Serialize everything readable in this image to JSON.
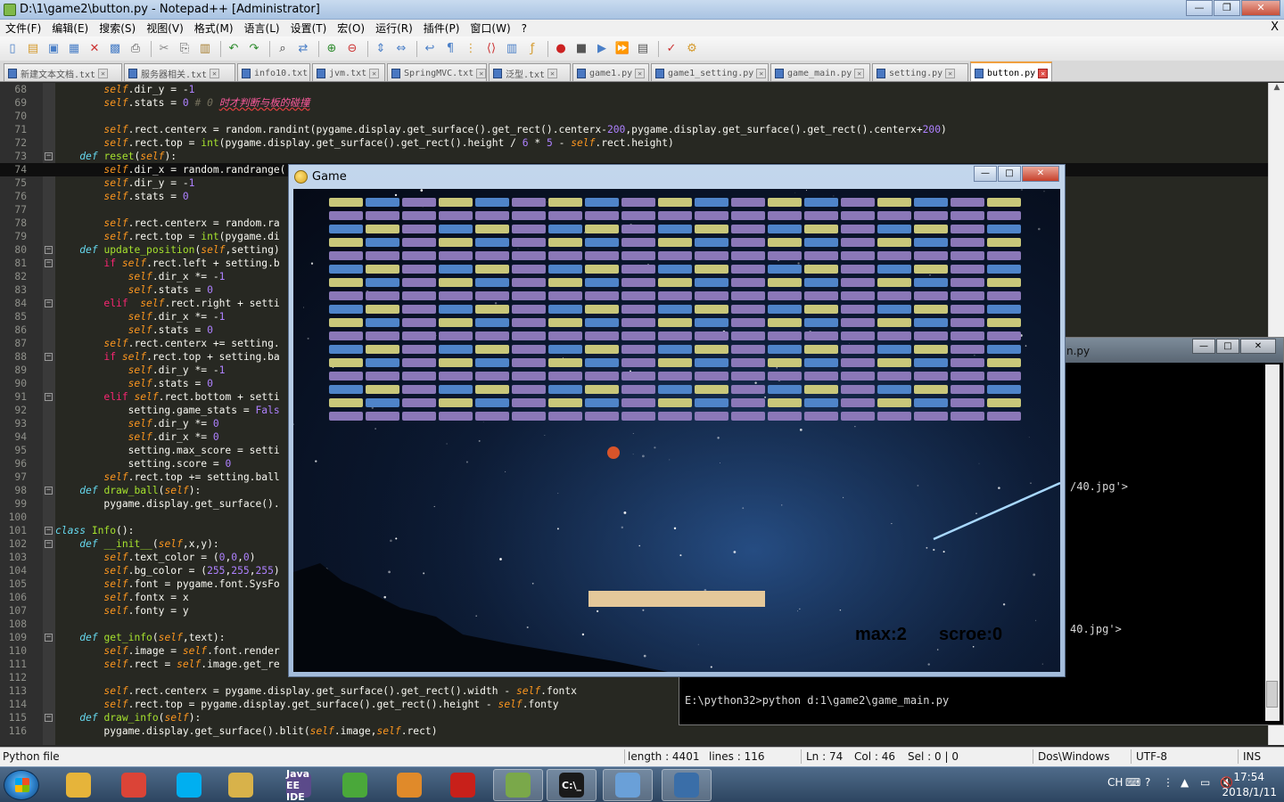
{
  "npp": {
    "title": "D:\\1\\game2\\button.py - Notepad++ [Administrator]",
    "menu": [
      "文件(F)",
      "编辑(E)",
      "搜索(S)",
      "视图(V)",
      "格式(M)",
      "语言(L)",
      "设置(T)",
      "宏(O)",
      "运行(R)",
      "插件(P)",
      "窗口(W)",
      "?"
    ],
    "menu_close": "X",
    "toolbar_icons": [
      "new-file-icon",
      "open-file-icon",
      "save-icon",
      "save-all-icon",
      "close-icon",
      "close-all-icon",
      "print-icon",
      "cut-icon",
      "copy-icon",
      "paste-icon",
      "undo-icon",
      "redo-icon",
      "find-icon",
      "replace-icon",
      "zoom-in-icon",
      "zoom-out-icon",
      "sync-v-icon",
      "sync-h-icon",
      "word-wrap-icon",
      "all-chars-icon",
      "indent-guide-icon",
      "lang-icon",
      "doc-map-icon",
      "function-list-icon",
      "record-macro-icon",
      "stop-macro-icon",
      "play-macro-icon",
      "run-macro-multiple-icon",
      "save-macro-icon",
      "spellcheck-icon",
      "plugin-icon"
    ],
    "tabs": [
      {
        "label": "新建文本文档.txt",
        "active": false
      },
      {
        "label": "服务器相关.txt",
        "active": false
      },
      {
        "label": "info10.txt",
        "active": false
      },
      {
        "label": "jvm.txt",
        "active": false
      },
      {
        "label": "SpringMVC.txt",
        "active": false
      },
      {
        "label": "泛型.txt",
        "active": false
      },
      {
        "label": "game1.py",
        "active": false
      },
      {
        "label": "game1_setting.py",
        "active": false
      },
      {
        "label": "game_main.py",
        "active": false
      },
      {
        "label": "setting.py",
        "active": false
      },
      {
        "label": "button.py",
        "active": true
      }
    ],
    "status": {
      "file_type": "Python file",
      "length": "length : 4401",
      "lines": "lines : 116",
      "ln": "Ln : 74",
      "col": "Col : 46",
      "sel": "Sel : 0 | 0",
      "eol": "Dos\\Windows",
      "encoding": "UTF-8",
      "mode": "INS"
    }
  },
  "code": [
    {
      "n": "68",
      "fold": "",
      "html": "        <span class=\"self\">self</span>.dir_y = -<span class=\"num\">1</span>"
    },
    {
      "n": "69",
      "fold": "",
      "html": "        <span class=\"self\">self</span>.stats = <span class=\"num\">0</span> <span class=\"cm\"># 0 </span><span class=\"cmcn\">时才判断与板的碰撞</span>"
    },
    {
      "n": "70",
      "fold": "",
      "html": ""
    },
    {
      "n": "71",
      "fold": "",
      "html": "        <span class=\"self\">self</span>.rect.centerx = random.randint(pygame.display.get_surface().get_rect().centerx-<span class=\"num\">200</span>,pygame.display.get_surface().get_rect().centerx+<span class=\"num\">200</span>)"
    },
    {
      "n": "72",
      "fold": "",
      "html": "        <span class=\"self\">self</span>.rect.top = <span class=\"fn\">int</span>(pygame.display.get_surface().get_rect().height / <span class=\"num\">6</span> * <span class=\"num\">5</span> - <span class=\"self\">self</span>.rect.height)"
    },
    {
      "n": "73",
      "fold": "−",
      "html": "    <span class=\"kw\">def</span> <span class=\"fn\">reset</span>(<span class=\"self\">self</span>):"
    },
    {
      "n": "74",
      "fold": "",
      "html": "        <span class=\"self\">self</span>.dir_x = random.randrange(",
      "current": true
    },
    {
      "n": "75",
      "fold": "",
      "html": "        <span class=\"self\">self</span>.dir_y = -<span class=\"num\">1</span>"
    },
    {
      "n": "76",
      "fold": "",
      "html": "        <span class=\"self\">self</span>.stats = <span class=\"num\">0</span>"
    },
    {
      "n": "77",
      "fold": "",
      "html": ""
    },
    {
      "n": "78",
      "fold": "",
      "html": "        <span class=\"self\">self</span>.rect.centerx = random.ra"
    },
    {
      "n": "79",
      "fold": "",
      "html": "        <span class=\"self\">self</span>.rect.top = <span class=\"fn\">int</span>(pygame.di"
    },
    {
      "n": "80",
      "fold": "−",
      "html": "    <span class=\"kw\">def</span> <span class=\"fn\">update_position</span>(<span class=\"self\">self</span>,setting)"
    },
    {
      "n": "81",
      "fold": "−",
      "html": "        <span class=\"kw2\">if</span> <span class=\"self\">self</span>.rect.left + setting.b"
    },
    {
      "n": "82",
      "fold": "",
      "html": "            <span class=\"self\">self</span>.dir_x *= -<span class=\"num\">1</span>"
    },
    {
      "n": "83",
      "fold": "",
      "html": "            <span class=\"self\">self</span>.stats = <span class=\"num\">0</span>"
    },
    {
      "n": "84",
      "fold": "−",
      "html": "        <span class=\"kw2\">elif</span>  <span class=\"self\">self</span>.rect.right + setti"
    },
    {
      "n": "85",
      "fold": "",
      "html": "            <span class=\"self\">self</span>.dir_x *= -<span class=\"num\">1</span>"
    },
    {
      "n": "86",
      "fold": "",
      "html": "            <span class=\"self\">self</span>.stats = <span class=\"num\">0</span>"
    },
    {
      "n": "87",
      "fold": "",
      "html": "        <span class=\"self\">self</span>.rect.centerx += setting."
    },
    {
      "n": "88",
      "fold": "−",
      "html": "        <span class=\"kw2\">if</span> <span class=\"self\">self</span>.rect.top + setting.ba"
    },
    {
      "n": "89",
      "fold": "",
      "html": "            <span class=\"self\">self</span>.dir_y *= -<span class=\"num\">1</span>"
    },
    {
      "n": "90",
      "fold": "",
      "html": "            <span class=\"self\">self</span>.stats = <span class=\"num\">0</span>"
    },
    {
      "n": "91",
      "fold": "−",
      "html": "        <span class=\"kw2\">elif</span> <span class=\"self\">self</span>.rect.bottom + setti"
    },
    {
      "n": "92",
      "fold": "",
      "html": "            setting.game_stats = <span class=\"num\">Fals</span>"
    },
    {
      "n": "93",
      "fold": "",
      "html": "            <span class=\"self\">self</span>.dir_y *= <span class=\"num\">0</span>"
    },
    {
      "n": "94",
      "fold": "",
      "html": "            <span class=\"self\">self</span>.dir_x *= <span class=\"num\">0</span>"
    },
    {
      "n": "95",
      "fold": "",
      "html": "            setting.max_score = setti"
    },
    {
      "n": "96",
      "fold": "",
      "html": "            setting.score = <span class=\"num\">0</span>"
    },
    {
      "n": "97",
      "fold": "",
      "html": "        <span class=\"self\">self</span>.rect.top += setting.ball"
    },
    {
      "n": "98",
      "fold": "−",
      "html": "    <span class=\"kw\">def</span> <span class=\"fn\">draw_ball</span>(<span class=\"self\">self</span>):"
    },
    {
      "n": "99",
      "fold": "",
      "html": "        pygame.display.get_surface()."
    },
    {
      "n": "100",
      "fold": "",
      "html": ""
    },
    {
      "n": "101",
      "fold": "−",
      "html": "<span class=\"kw\">class</span> <span class=\"fn\">Info</span>():"
    },
    {
      "n": "102",
      "fold": "−",
      "html": "    <span class=\"kw\">def</span> <span class=\"fn\">__init__</span>(<span class=\"self\">self</span>,x,y):"
    },
    {
      "n": "103",
      "fold": "",
      "html": "        <span class=\"self\">self</span>.text_color = (<span class=\"num\">0</span>,<span class=\"num\">0</span>,<span class=\"num\">0</span>)"
    },
    {
      "n": "104",
      "fold": "",
      "html": "        <span class=\"self\">self</span>.bg_color = (<span class=\"num\">255</span>,<span class=\"num\">255</span>,<span class=\"num\">255</span>)"
    },
    {
      "n": "105",
      "fold": "",
      "html": "        <span class=\"self\">self</span>.font = pygame.font.SysFo"
    },
    {
      "n": "106",
      "fold": "",
      "html": "        <span class=\"self\">self</span>.fontx = x"
    },
    {
      "n": "107",
      "fold": "",
      "html": "        <span class=\"self\">self</span>.fonty = y"
    },
    {
      "n": "108",
      "fold": "",
      "html": ""
    },
    {
      "n": "109",
      "fold": "−",
      "html": "    <span class=\"kw\">def</span> <span class=\"fn\">get_info</span>(<span class=\"self\">self</span>,text):"
    },
    {
      "n": "110",
      "fold": "",
      "html": "        <span class=\"self\">self</span>.image = <span class=\"self\">self</span>.font.render"
    },
    {
      "n": "111",
      "fold": "",
      "html": "        <span class=\"self\">self</span>.rect = <span class=\"self\">self</span>.image.get_re"
    },
    {
      "n": "112",
      "fold": "",
      "html": ""
    },
    {
      "n": "113",
      "fold": "",
      "html": "        <span class=\"self\">self</span>.rect.centerx = pygame.display.get_surface().get_rect().width - <span class=\"self\">self</span>.fontx"
    },
    {
      "n": "114",
      "fold": "",
      "html": "        <span class=\"self\">self</span>.rect.top = pygame.display.get_surface().get_rect().height - <span class=\"self\">self</span>.fonty"
    },
    {
      "n": "115",
      "fold": "−",
      "html": "    <span class=\"kw\">def</span> <span class=\"fn\">draw_info</span>(<span class=\"self\">self</span>):"
    },
    {
      "n": "116",
      "fold": "",
      "html": "        pygame.display.get_surface().blit(<span class=\"self\">self</span>.image,<span class=\"self\">self</span>.rect)"
    }
  ],
  "console": {
    "title_fragment": "n.py",
    "lines": [
      "/40.jpg'>",
      "40.jpg'>",
      "E:\\python32>python d:1\\game2\\game_main.py"
    ]
  },
  "game": {
    "title": "Game",
    "max_label": "max:2",
    "score_label": "scroe:0",
    "brick_colors": [
      "#c9c77a",
      "#8b78b8",
      "#4f84c9"
    ],
    "paddle_color": "#e4c89a",
    "ball_color": "#d8542a"
  },
  "taskbar": {
    "apps": [
      {
        "name": "explorer-folder-icon",
        "label": ""
      },
      {
        "name": "chrome-icon",
        "label": ""
      },
      {
        "name": "skype-icon",
        "label": ""
      },
      {
        "name": "file-manager-icon",
        "label": ""
      },
      {
        "name": "java-ee-ide-icon",
        "label": "Java EE IDE"
      },
      {
        "name": "lime-app-icon",
        "label": ""
      },
      {
        "name": "outlook-icon",
        "label": ""
      },
      {
        "name": "acrobat-icon",
        "label": ""
      },
      {
        "name": "notepadpp-icon",
        "label": ""
      },
      {
        "name": "cmd-icon",
        "label": "C:\\_"
      },
      {
        "name": "paint-icon",
        "label": ""
      },
      {
        "name": "python-icon",
        "label": ""
      }
    ],
    "tray_lang": "CH",
    "time": "17:54",
    "date": "2018/1/11"
  }
}
